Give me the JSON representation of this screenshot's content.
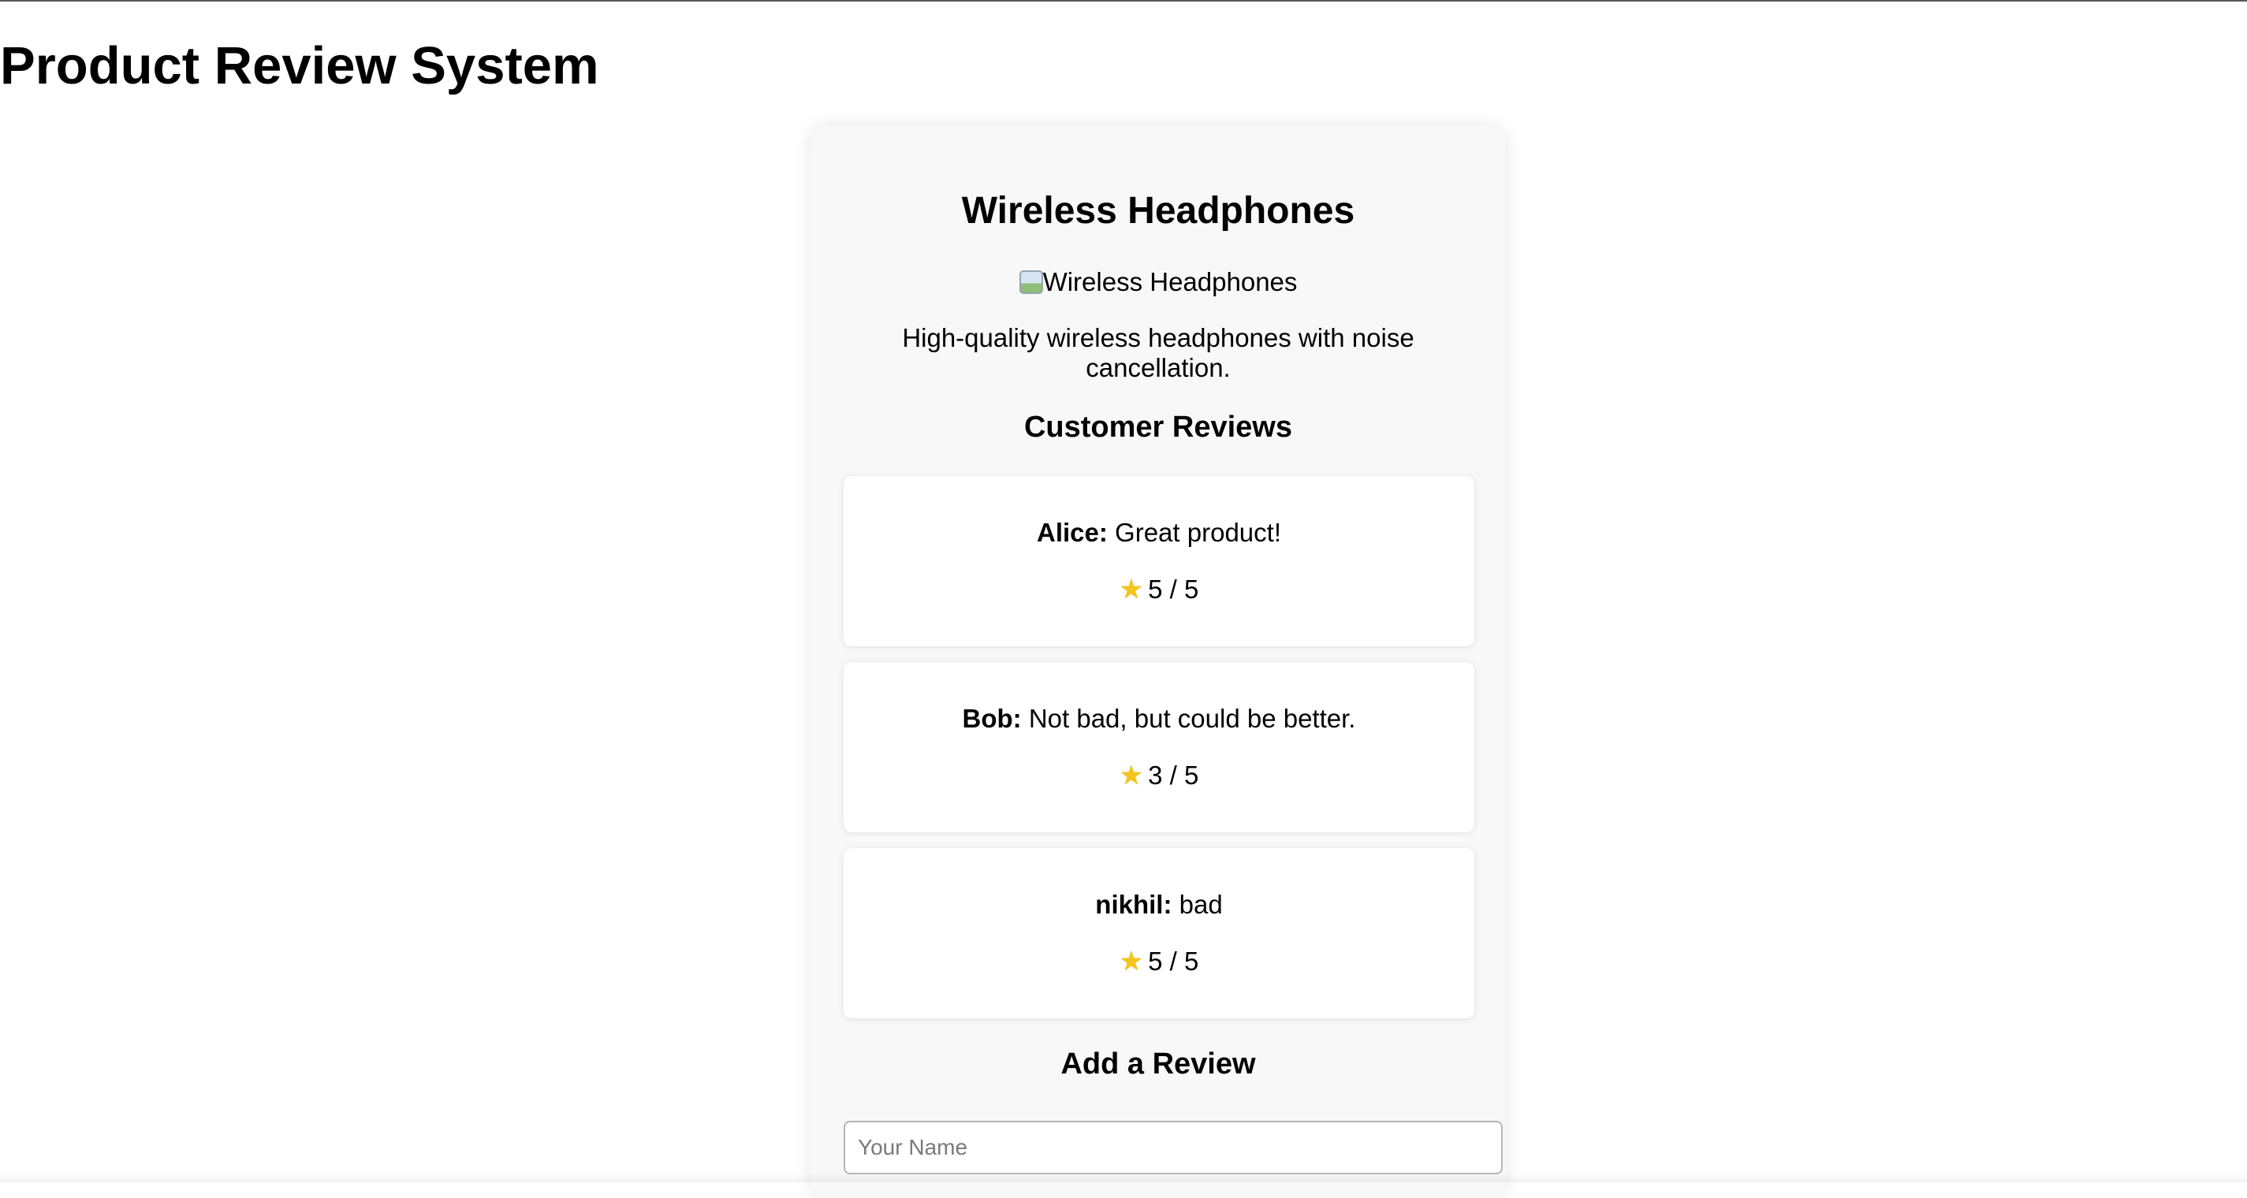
{
  "page": {
    "title": "Product Review System"
  },
  "product": {
    "name": "Wireless Headphones",
    "image_alt": "Wireless Headphones",
    "description": "High-quality wireless headphones with noise cancellation."
  },
  "reviews_section": {
    "title": "Customer Reviews",
    "rating_suffix": "/ 5",
    "items": [
      {
        "author": "Alice:",
        "comment": "Great product!",
        "rating": 5,
        "rating_text": "5 / 5"
      },
      {
        "author": "Bob:",
        "comment": "Not bad, but could be better.",
        "rating": 3,
        "rating_text": "3 / 5"
      },
      {
        "author": "nikhil:",
        "comment": "bad",
        "rating": 5,
        "rating_text": "5 / 5"
      }
    ]
  },
  "add_review": {
    "title": "Add a Review",
    "name_placeholder": "Your Name",
    "name_value": ""
  },
  "icons": {
    "rating": "star-icon",
    "image_placeholder": "broken-image-icon"
  },
  "colors": {
    "star": "#f4c51c",
    "card_background": "#f8f8f8",
    "review_background": "#ffffff"
  }
}
